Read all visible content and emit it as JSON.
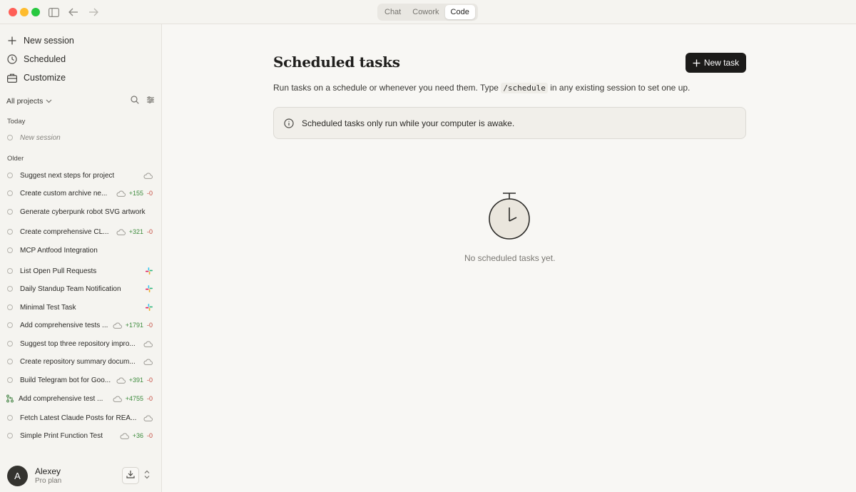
{
  "titlebar": {
    "modes": [
      "Chat",
      "Cowork",
      "Code"
    ],
    "active_mode": "Code"
  },
  "sidebar": {
    "nav": [
      {
        "label": "New session",
        "icon": "plus-icon"
      },
      {
        "label": "Scheduled",
        "icon": "clock-icon"
      },
      {
        "label": "Customize",
        "icon": "briefcase-icon"
      }
    ],
    "project_filter": "All projects",
    "sections": {
      "today": "Today",
      "older": "Older"
    },
    "today_sessions": [
      {
        "title": "New session"
      }
    ],
    "older_sessions": [
      {
        "title": "Suggest next steps for project",
        "cloud": true
      },
      {
        "title": "Create custom archive ne...",
        "cloud": true,
        "added": "+155",
        "removed": "-0"
      },
      {
        "title": "Generate cyberpunk robot SVG artwork"
      },
      {
        "title": "Create comprehensive CL...",
        "cloud": true,
        "added": "+321",
        "removed": "-0"
      },
      {
        "title": "MCP Antfood Integration"
      },
      {
        "title": "List Open Pull Requests",
        "slack": true
      },
      {
        "title": "Daily Standup Team Notification",
        "slack": true
      },
      {
        "title": "Minimal Test Task",
        "slack": true
      },
      {
        "title": "Add comprehensive tests ...",
        "cloud": true,
        "added": "+1791",
        "removed": "-0"
      },
      {
        "title": "Suggest top three repository impro...",
        "cloud": true
      },
      {
        "title": "Create repository summary docum...",
        "cloud": true
      },
      {
        "title": "Build Telegram bot for Goo...",
        "cloud": true,
        "added": "+391",
        "removed": "-0"
      },
      {
        "title": "Add comprehensive test ...",
        "cloud": true,
        "added": "+4755",
        "removed": "-0",
        "branch": true
      },
      {
        "title": "Fetch Latest Claude Posts for REA...",
        "cloud": true
      },
      {
        "title": "Simple Print Function Test",
        "cloud": true,
        "added": "+36",
        "removed": "-0"
      }
    ],
    "user": {
      "initial": "A",
      "name": "Alexey",
      "plan": "Pro plan"
    }
  },
  "main": {
    "title": "Scheduled tasks",
    "new_task_label": "New task",
    "subtitle_before": "Run tasks on a schedule or whenever you need them. Type ",
    "subtitle_code": "/schedule",
    "subtitle_after": " in any existing session to set one up.",
    "notice": "Scheduled tasks only run while your computer is awake.",
    "empty_state": "No scheduled tasks yet."
  },
  "colors": {
    "accent_dark": "#1c1b19",
    "added": "#3d8b3d",
    "removed": "#c4493d"
  }
}
